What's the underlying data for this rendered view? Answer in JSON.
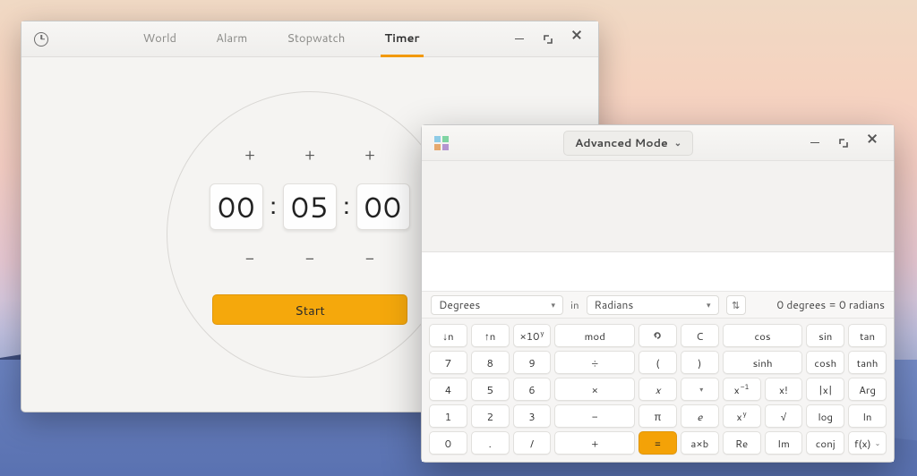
{
  "clocks": {
    "tabs": [
      "World",
      "Alarm",
      "Stopwatch",
      "Timer"
    ],
    "active_tab": "Timer",
    "timer": {
      "hours": "00",
      "minutes": "05",
      "seconds": "00",
      "plus": "+",
      "minus": "−",
      "start_label": "Start"
    }
  },
  "calc": {
    "mode_label": "Advanced Mode",
    "conversion": {
      "from_label": "Degrees",
      "in_word": "in",
      "to_label": "Radians",
      "result": "0 degrees  =  0 radians"
    },
    "keys": [
      [
        "↓n",
        "↑n",
        "×10ʸ",
        "mod",
        "UNDO_ICON",
        "C",
        "cos",
        "sin",
        "tan"
      ],
      [
        "7",
        "8",
        "9",
        "÷",
        "(",
        ")",
        "sinh",
        "cosh",
        "tanh"
      ],
      [
        "4",
        "5",
        "6",
        "×",
        "x",
        "DROP_ICON",
        "x⁻¹",
        "x!",
        "|x|",
        "Arg"
      ],
      [
        "1",
        "2",
        "3",
        "−",
        "π",
        "e",
        "xʸ",
        "√",
        "log",
        "ln"
      ],
      [
        "0",
        ".",
        "/",
        "+",
        "=",
        "a×b",
        "Re",
        "Im",
        "conj",
        "f(x) ˅"
      ]
    ]
  }
}
